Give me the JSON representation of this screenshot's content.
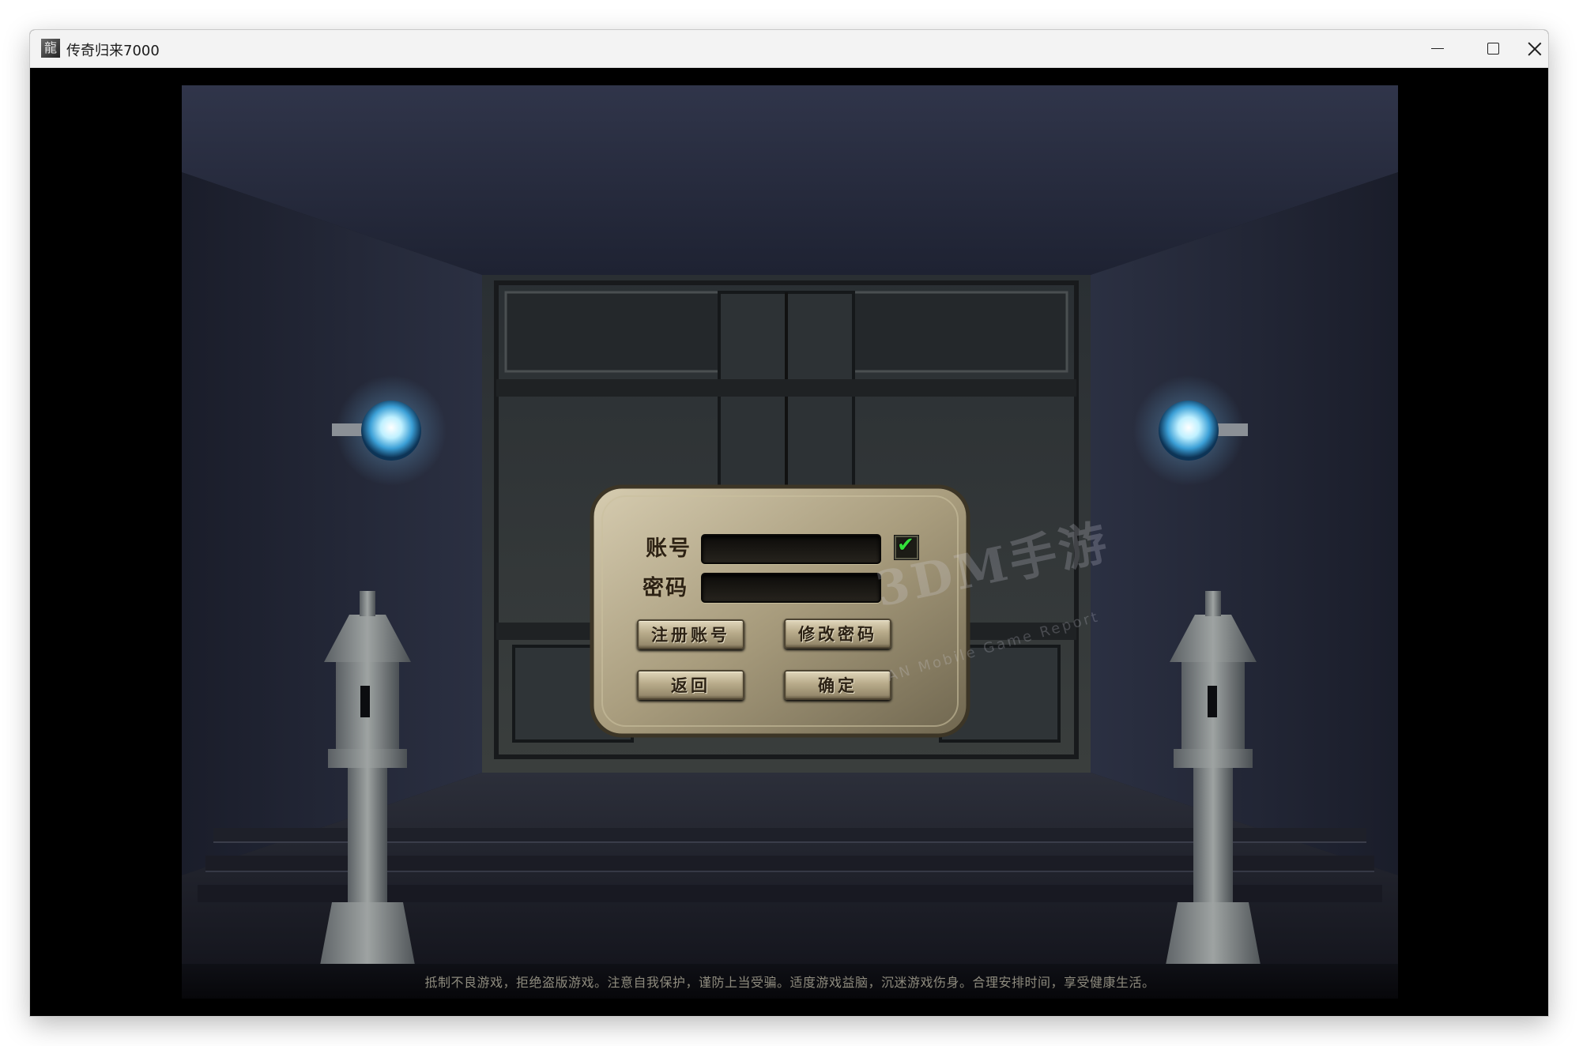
{
  "window": {
    "title": "传奇归来7000",
    "icon": "dragon-app-icon",
    "controls": [
      "minimize-icon",
      "maximize-icon",
      "close-icon"
    ]
  },
  "login": {
    "account_label": "账号",
    "password_label": "密码",
    "account_value": "",
    "password_value": "",
    "remember_checked": true,
    "check_glyph": "✔",
    "register_label": "注册账号",
    "change_password_label": "修改密码",
    "back_label": "返回",
    "confirm_label": "确定"
  },
  "footer": {
    "notice": "抵制不良游戏，拒绝盗版游戏。注意自我保护，谨防上当受骗。适度游戏益脑，沉迷游戏伤身。合理安排时间，享受健康生活。"
  },
  "watermark": {
    "main": "3DM手游",
    "sub": "AN Mobile Game Report"
  },
  "colors": {
    "orb": "#7fd4ff",
    "checkmark": "#33e03a",
    "stone": "#b8ab8a"
  }
}
